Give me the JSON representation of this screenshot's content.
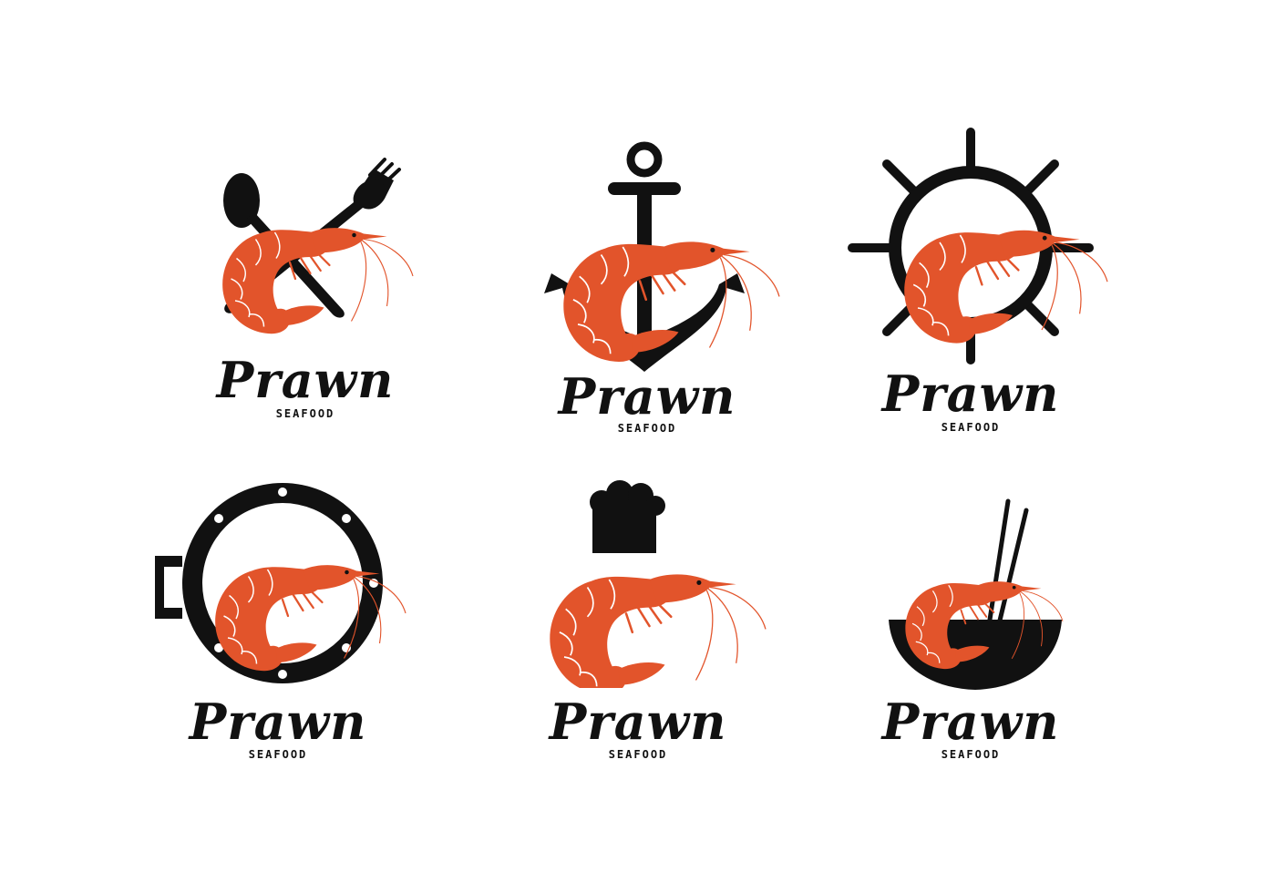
{
  "colors": {
    "accent": "#e2542b",
    "ink": "#111111",
    "background": "#ffffff"
  },
  "logos": [
    {
      "emblem": "fork-and-spoon-icon",
      "brand": "Prawn",
      "tagline": "SEAFOOD"
    },
    {
      "emblem": "anchor-icon",
      "brand": "Prawn",
      "tagline": "SEAFOOD"
    },
    {
      "emblem": "ship-wheel-icon",
      "brand": "Prawn",
      "tagline": "SEAFOOD"
    },
    {
      "emblem": "porthole-icon",
      "brand": "Prawn",
      "tagline": "SEAFOOD"
    },
    {
      "emblem": "chef-hat-icon",
      "brand": "Prawn",
      "tagline": "SEAFOOD"
    },
    {
      "emblem": "bowl-chopsticks-icon",
      "brand": "Prawn",
      "tagline": "SEAFOOD"
    }
  ]
}
